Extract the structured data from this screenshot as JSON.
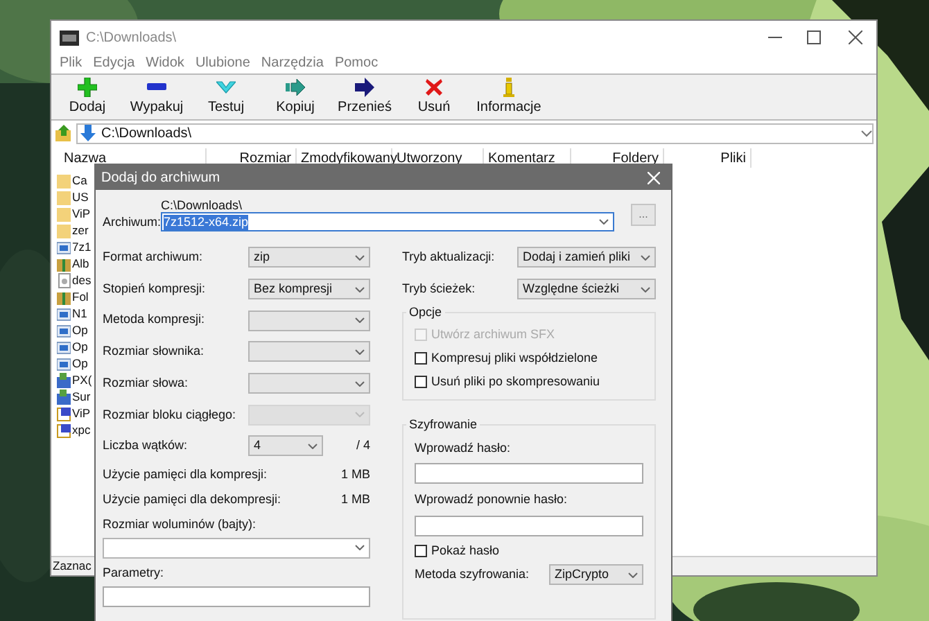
{
  "window": {
    "title": "C:\\Downloads\\"
  },
  "menu": [
    "Plik",
    "Edycja",
    "Widok",
    "Ulubione",
    "Narzędzia",
    "Pomoc"
  ],
  "toolbar": [
    {
      "label": "Dodaj",
      "kind": "add"
    },
    {
      "label": "Wypakuj",
      "kind": "extract"
    },
    {
      "label": "Testuj",
      "kind": "test"
    },
    {
      "label": "Kopiuj",
      "kind": "copy"
    },
    {
      "label": "Przenieś",
      "kind": "move"
    },
    {
      "label": "Usuń",
      "kind": "delete"
    },
    {
      "label": "Informacje",
      "kind": "info"
    }
  ],
  "address": {
    "value": "C:\\Downloads\\"
  },
  "file_list": {
    "columns": [
      "Nazwa",
      "Rozmiar",
      "Zmodyfikowany",
      "Utworzony",
      "Komentarz",
      "Foldery",
      "Pliki"
    ],
    "rows": [
      {
        "name": "Ca",
        "kind": "folder"
      },
      {
        "name": "US",
        "kind": "folder"
      },
      {
        "name": "ViP",
        "kind": "folder"
      },
      {
        "name": "zer",
        "kind": "folder"
      },
      {
        "name": "7z1",
        "kind": "app"
      },
      {
        "name": "Alb",
        "kind": "archive"
      },
      {
        "name": "des",
        "kind": "doc"
      },
      {
        "name": "Fol",
        "kind": "archive"
      },
      {
        "name": "N1",
        "kind": "app"
      },
      {
        "name": "Op",
        "kind": "app"
      },
      {
        "name": "Op",
        "kind": "app"
      },
      {
        "name": "Op",
        "kind": "app"
      },
      {
        "name": "PX(",
        "kind": "installer"
      },
      {
        "name": "Sur",
        "kind": "installer"
      },
      {
        "name": "ViP",
        "kind": "link"
      },
      {
        "name": "xpc",
        "kind": "link"
      }
    ]
  },
  "status_bar": "Zaznac",
  "dialog": {
    "title": "Dodaj do archiwum",
    "archive": {
      "label": "Archiwum:",
      "path": "C:\\Downloads\\",
      "value": "7z1512-x64.zip",
      "browse": "..."
    },
    "left_fields": [
      {
        "kind": "combo",
        "label": "Format archiwum:",
        "value": "zip",
        "disabled": false
      },
      {
        "kind": "combo",
        "label": "Stopień kompresji:",
        "value": "Bez kompresji",
        "disabled": false
      },
      {
        "kind": "combo",
        "label": "Metoda kompresji:",
        "disabled": false
      },
      {
        "kind": "combo",
        "label": "Rozmiar słownika:",
        "disabled": false
      },
      {
        "kind": "combo",
        "label": "Rozmiar słowa:",
        "disabled": false
      },
      {
        "kind": "combo",
        "label": "Rozmiar bloku ciągłego:",
        "disabled": true
      },
      {
        "kind": "threads",
        "label": "Liczba wątków:",
        "value": "4",
        "suffix": "/ 4",
        "disabled": false
      },
      {
        "kind": "info",
        "label": "Użycie pamięci dla kompresji:",
        "value": "1 MB"
      },
      {
        "kind": "info",
        "label": "Użycie pamięci dla dekompresji:",
        "value": "1 MB"
      }
    ],
    "volume_size": {
      "label": "Rozmiar woluminów (bajty):"
    },
    "parameters": {
      "label": "Parametry:"
    },
    "update_mode": {
      "label": "Tryb aktualizacji:",
      "value": "Dodaj i zamień pliki"
    },
    "path_mode": {
      "label": "Tryb ścieżek:",
      "value": "Względne ścieżki"
    },
    "options": {
      "title": "Opcje",
      "items": [
        {
          "label": "Utwórz archiwum SFX",
          "checked": false,
          "disabled": true
        },
        {
          "label": "Kompresuj pliki współdzielone",
          "checked": false,
          "disabled": false
        },
        {
          "label": "Usuń pliki po skompresowaniu",
          "checked": false,
          "disabled": false
        }
      ]
    },
    "encryption": {
      "title": "Szyfrowanie",
      "password_label": "Wprowadź hasło:",
      "repeat_label": "Wprowadź ponownie hasło:",
      "show_password": {
        "label": "Pokaż hasło",
        "checked": false
      },
      "method": {
        "label": "Metoda szyfrowania:",
        "value": "ZipCrypto"
      }
    }
  }
}
